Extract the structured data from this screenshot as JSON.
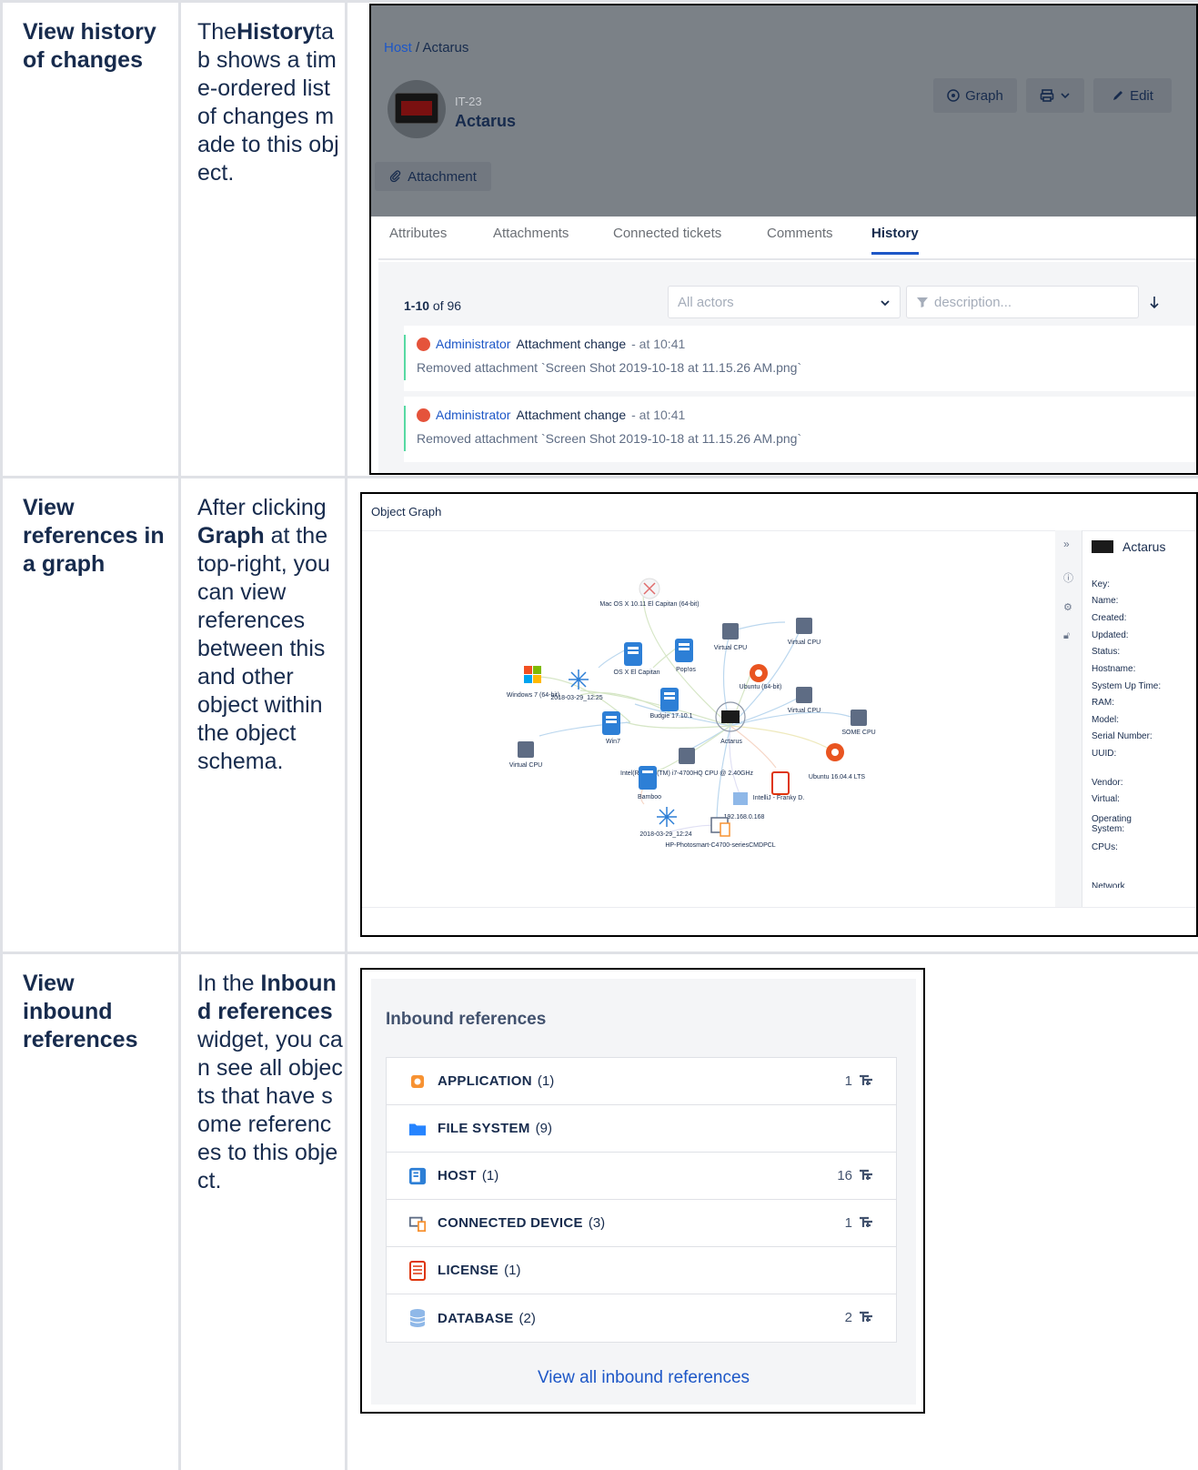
{
  "rows": [
    {
      "title": "View history of changes",
      "desc_parts": [
        "The",
        "History",
        "tab shows a time-ordered list of changes made to this object."
      ]
    },
    {
      "title": "View references in a graph",
      "desc_parts": [
        "After clicking ",
        "Graph",
        " at the top-right, you can view references between this and other object within the object schema."
      ]
    },
    {
      "title": "View inbound references",
      "desc_parts": [
        "In the ",
        "Inbound references",
        " widget, you can see all objects that have some references to this object."
      ]
    }
  ],
  "history_shot": {
    "breadcrumb_link": "Host",
    "breadcrumb_rest": " / Actarus",
    "object_key": "IT-23",
    "object_name": "Actarus",
    "graph_button": "Graph",
    "edit_button": "Edit",
    "attachment_button": "Attachment",
    "tabs": [
      "Attributes",
      "Attachments",
      "Connected tickets",
      "Comments",
      "History"
    ],
    "active_tab": "History",
    "count_bold": "1-10",
    "count_rest": " of 96",
    "actors_placeholder": "All actors",
    "description_placeholder": "description...",
    "entries": [
      {
        "actor": "Administrator",
        "change": "Attachment change",
        "time": "- at 10:41",
        "detail": "Removed attachment `Screen Shot 2019-10-18 at 11.15.26 AM.png`"
      },
      {
        "actor": "Administrator",
        "change": "Attachment change",
        "time": "- at 10:41",
        "detail": "Removed attachment `Screen Shot 2019-10-18 at 11.15.26 AM.png`"
      }
    ]
  },
  "graph_shot": {
    "title": "Object Graph",
    "panel_object": "Actarus",
    "attribute_labels": [
      "Key:",
      "Name:",
      "Created:",
      "Updated:",
      "Status:",
      "Hostname:",
      "System Up Time:",
      "RAM:",
      "Model:",
      "Serial Number:",
      "UUID:",
      "Vendor:",
      "Virtual:",
      "Operating System:",
      "CPUs:",
      "Network"
    ],
    "nodes": [
      "Mac OS X 10.11 El Capitan (64-bit)",
      "Virtual CPU",
      "Virtual CPU",
      "OS X El Capitan",
      "Pop!os",
      "Ubuntu (64-bit)",
      "Windows 7 (64-bit)",
      "2018-03-29_12:25",
      "Budgie 17.10.1",
      "Virtual CPU",
      "SOME CPU",
      "Actarus",
      "Win7",
      "Virtual CPU",
      "Intel(R) Core(TM) i7-4700HQ CPU @ 2.40GHz",
      "Ubuntu 16.04.4 LTS",
      "Bamboo",
      "IntelliJ - Franky D.",
      "192.168.0.168",
      "2018-03-29_12:24",
      "HP-Photosmart-C4700-seriesCMDPCL"
    ]
  },
  "inbound_shot": {
    "title": "Inbound references",
    "items": [
      {
        "label": "APPLICATION",
        "count": "(1)",
        "refs": "1",
        "icon": "application-icon",
        "color": "#f79232"
      },
      {
        "label": "FILE SYSTEM",
        "count": "(9)",
        "refs": "",
        "icon": "folder-icon",
        "color": "#2684ff"
      },
      {
        "label": "HOST",
        "count": "(1)",
        "refs": "16",
        "icon": "host-icon",
        "color": "#2d7fd6"
      },
      {
        "label": "CONNECTED DEVICE",
        "count": "(3)",
        "refs": "1",
        "icon": "device-icon",
        "color": "#f79232"
      },
      {
        "label": "LICENSE",
        "count": "(1)",
        "refs": "",
        "icon": "license-icon",
        "color": "#de350b"
      },
      {
        "label": "DATABASE",
        "count": "(2)",
        "refs": "2",
        "icon": "database-icon",
        "color": "#8fb8e8"
      }
    ],
    "view_all": "View all inbound references"
  }
}
